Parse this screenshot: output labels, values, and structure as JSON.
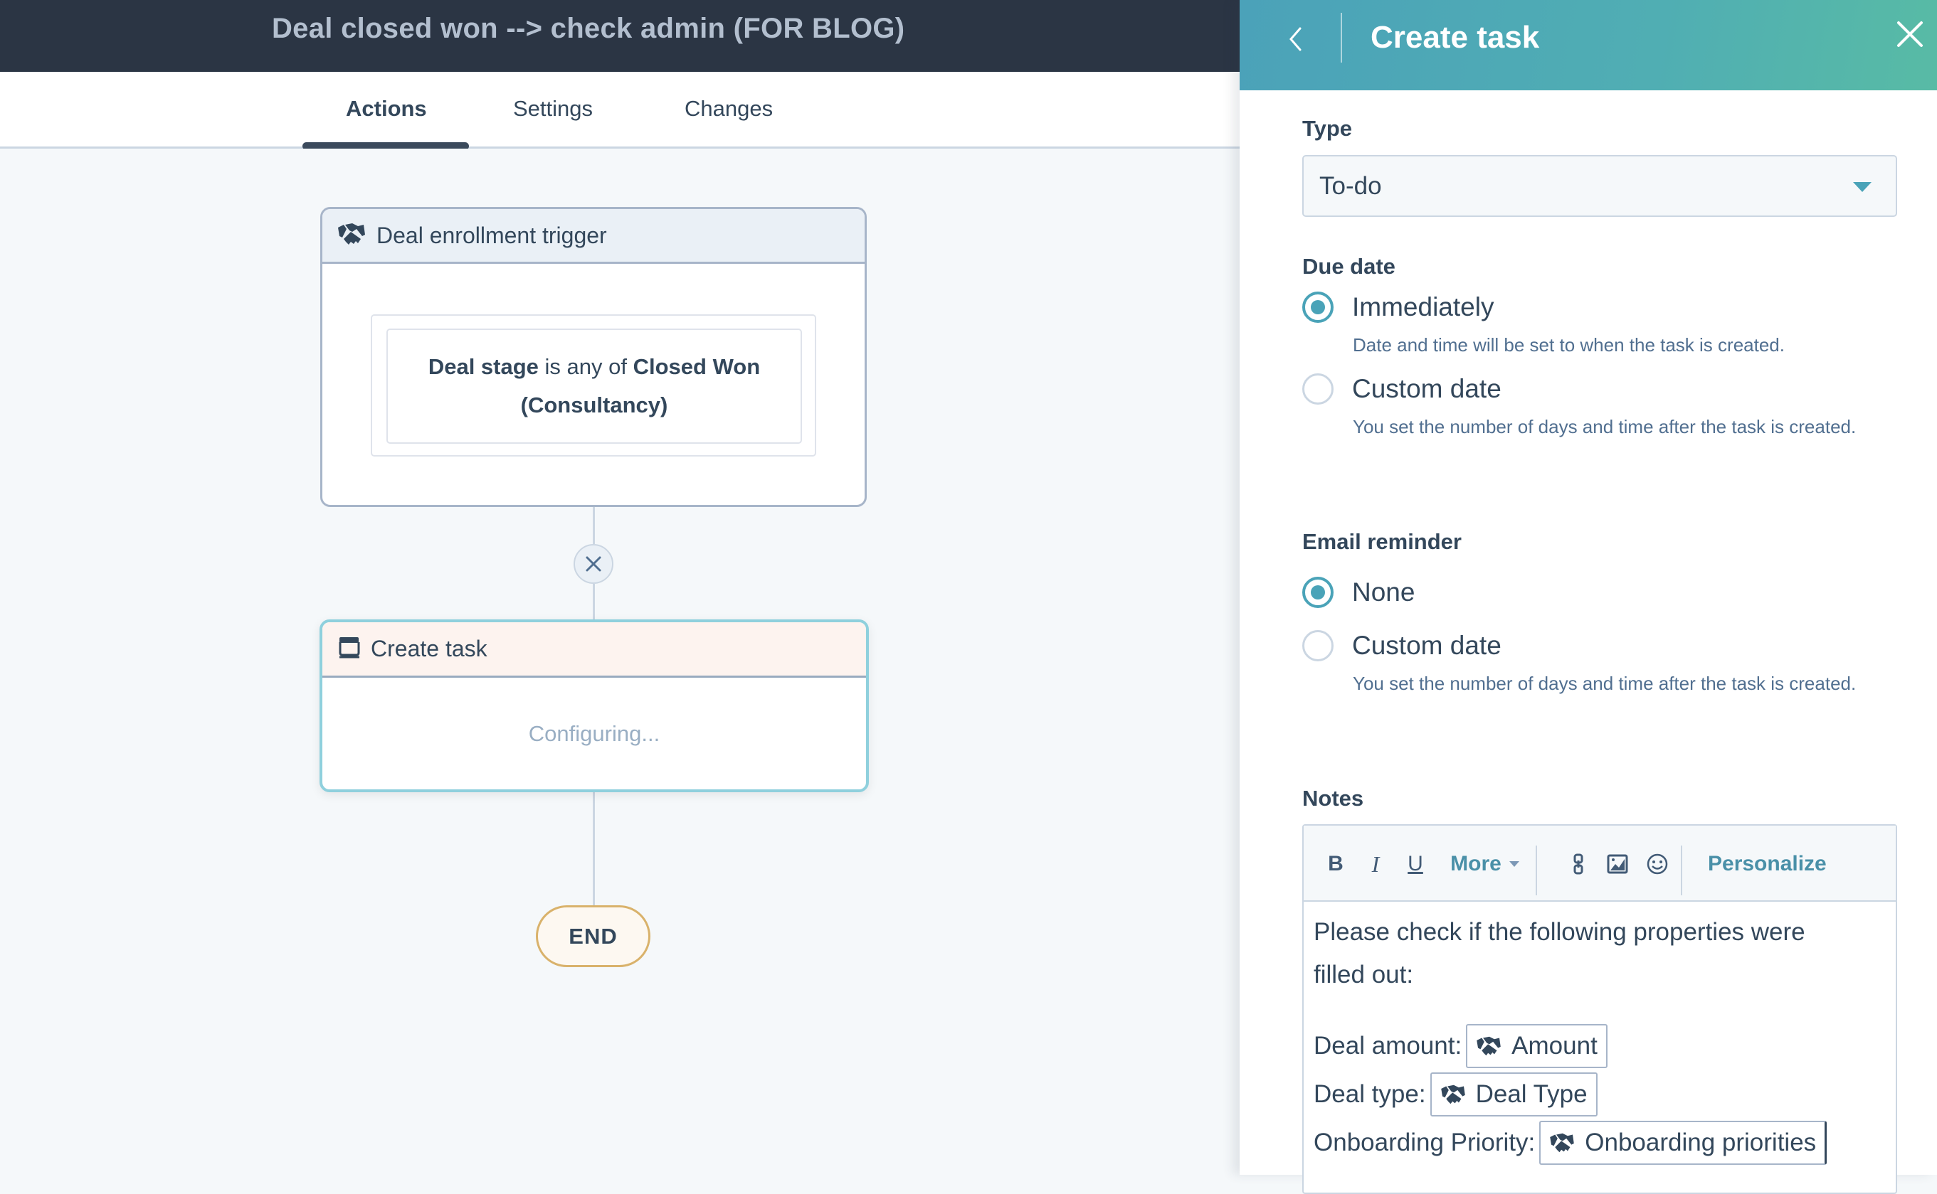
{
  "workflow": {
    "title": "Deal closed won --> check admin (FOR BLOG)"
  },
  "tabs": [
    {
      "label": "Actions",
      "active": true
    },
    {
      "label": "Settings",
      "active": false
    },
    {
      "label": "Changes",
      "active": false
    }
  ],
  "canvas": {
    "trigger": {
      "icon": "handshake-icon",
      "label": "Deal enrollment trigger",
      "filter": {
        "property": "Deal stage",
        "operator": "is any of",
        "value": "Closed Won (Consultancy)"
      }
    },
    "action": {
      "icon": "task-icon",
      "label": "Create task",
      "status": "Configuring..."
    },
    "end_label": "END"
  },
  "panel": {
    "title": "Create task",
    "type": {
      "label": "Type",
      "value": "To-do"
    },
    "due_date": {
      "label": "Due date",
      "options": [
        {
          "label": "Immediately",
          "checked": true,
          "help": "Date and time will be set to when the task is created."
        },
        {
          "label": "Custom date",
          "checked": false,
          "help": "You set the number of days and time after the task is created."
        }
      ]
    },
    "email_reminder": {
      "label": "Email reminder",
      "options": [
        {
          "label": "None",
          "checked": true,
          "help": ""
        },
        {
          "label": "Custom date",
          "checked": false,
          "help": "You set the number of days and time after the task is created."
        }
      ]
    },
    "notes": {
      "label": "Notes",
      "toolbar": {
        "bold": "B",
        "italic": "I",
        "underline": "U",
        "more": "More",
        "personalize": "Personalize"
      },
      "body": {
        "intro": "Please check if the following properties were filled out:",
        "rows": [
          {
            "label": "Deal amount:",
            "token": "Amount"
          },
          {
            "label": "Deal type:",
            "token": "Deal Type"
          },
          {
            "label": "Onboarding Priority:",
            "token": "Onboarding priorities"
          }
        ]
      }
    }
  },
  "colors": {
    "header_bg": "#2b3544",
    "accent": "#4aa3b8",
    "panel_header_start": "#4ba2b9",
    "panel_header_end": "#58bba5",
    "end_border": "#d9b26b"
  }
}
